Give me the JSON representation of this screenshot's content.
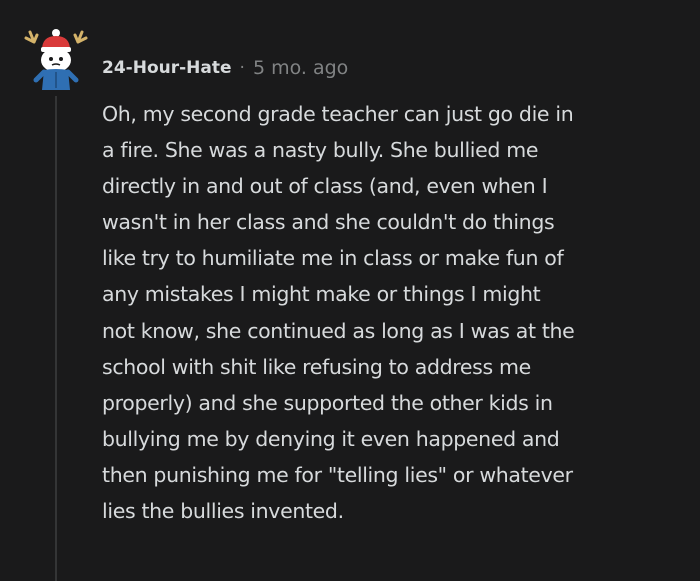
{
  "comment": {
    "author": "24-Hour-Hate",
    "separator": "·",
    "timestamp": "5 mo. ago",
    "avatar_icon": "snoo-avatar-icon",
    "body": "Oh, my second grade teacher can just go die in\na fire. She was a nasty bully. She bullied me\ndirectly in and out of class (and, even when I\nwasn't in her class and she couldn't do things\nlike try to humiliate me in class or make fun of\nany mistakes I might make or things I might\nnot know, she continued as long as I was at the\nschool with shit like refusing to address me\nproperly) and she supported the other kids in\nbullying me by denying it even happened and\nthen punishing me for \"telling lies\" or whatever\nlies the bullies invented."
  },
  "colors": {
    "background": "#1a1a1b",
    "text": "#d7dadc",
    "muted": "#818384",
    "thread_line": "#343536",
    "hat_red": "#d93a3a",
    "jacket_blue": "#2f6fb3"
  }
}
